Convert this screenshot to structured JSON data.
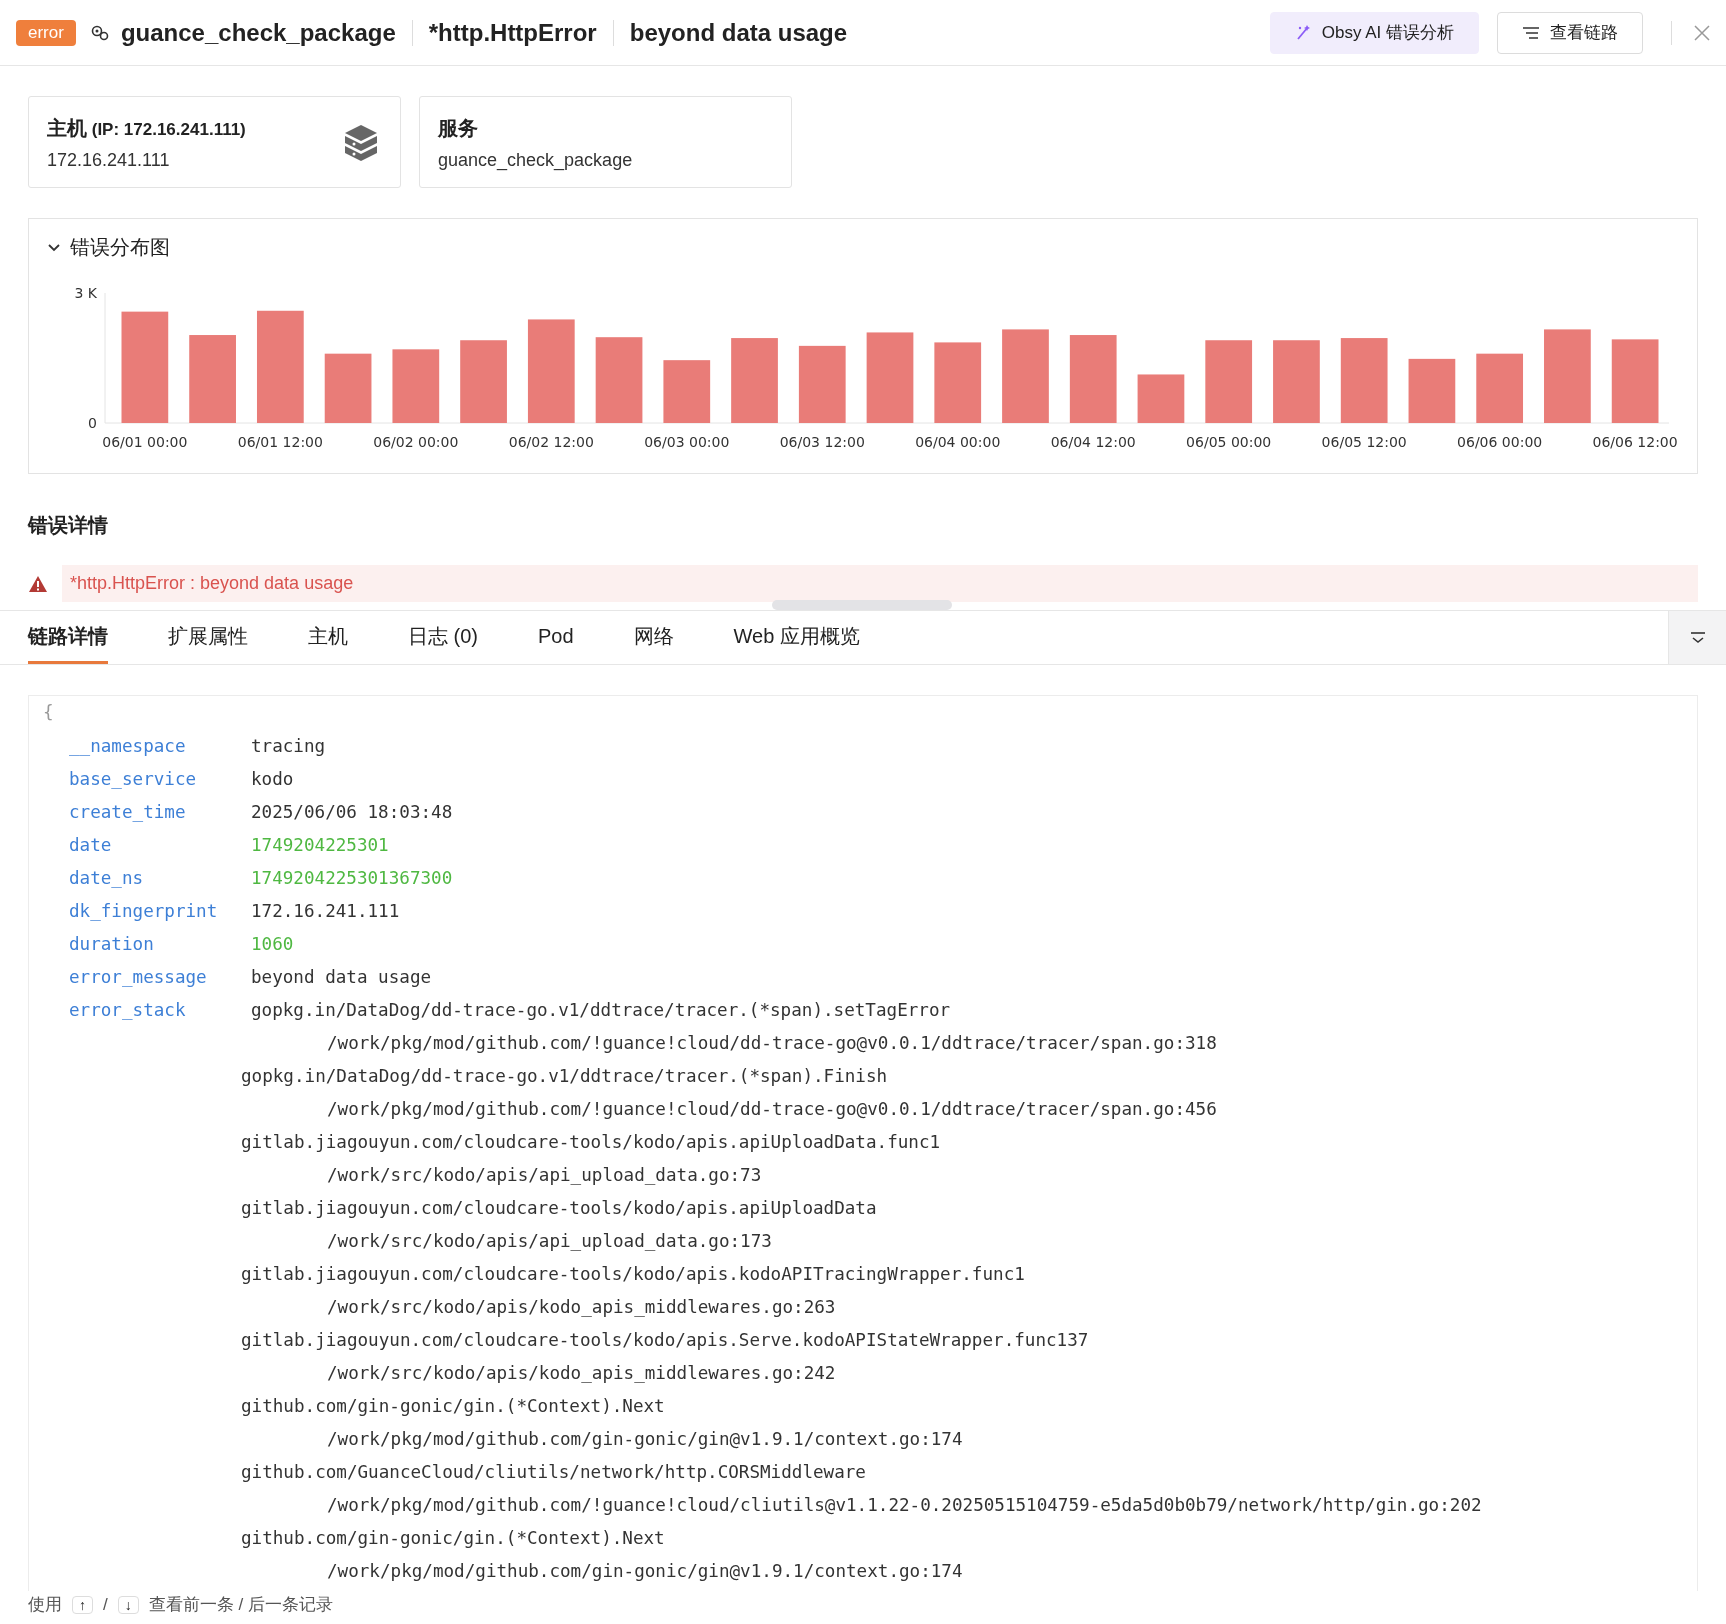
{
  "header": {
    "badge": "error",
    "service": "guance_check_package",
    "error_type": "*http.HttpError",
    "message": "beyond data usage",
    "buttons": [
      {
        "label": "Obsy AI 错误分析",
        "kind": "ai"
      },
      {
        "label": "查看链路",
        "kind": "trace"
      }
    ]
  },
  "cards": [
    {
      "kind": "host",
      "title": "主机",
      "subtitle": "(IP: 172.16.241.111)",
      "value": "172.16.241.111"
    },
    {
      "kind": "service",
      "title": "服务",
      "value": "guance_check_package"
    }
  ],
  "chart_panel": {
    "title": "错误分布图",
    "expanded": true,
    "chart_data": {
      "type": "bar",
      "categories": [
        "06/01 00:00",
        null,
        "06/01 12:00",
        null,
        "06/02 00:00",
        null,
        "06/02 12:00",
        null,
        "06/03 00:00",
        null,
        "06/03 12:00",
        null,
        "06/04 00:00",
        null,
        "06/04 12:00",
        null,
        "06/05 00:00",
        null,
        "06/05 12:00",
        null,
        "06/06 00:00",
        null,
        "06/06 12:00"
      ],
      "series": [
        {
          "color": "#e97c78",
          "values": [
            2570,
            2030,
            2590,
            1600,
            1700,
            1910,
            2390,
            1980,
            1450,
            1960,
            1780,
            2090,
            1860,
            2160,
            2030,
            1120,
            1910,
            1910,
            1960,
            1480,
            1600,
            2160,
            1930
          ]
        }
      ],
      "ylim": [
        0,
        3000
      ],
      "yticks": [
        {
          "value": 0,
          "label": "0"
        },
        {
          "value": 3000,
          "label": "3 K"
        }
      ]
    }
  },
  "details": {
    "title": "错误详情",
    "error": "*http.HttpError : beyond data usage"
  },
  "tabs": [
    {
      "label": "链路详情",
      "selected": true
    },
    {
      "label": "扩展属性",
      "selected": false
    },
    {
      "label": "主机",
      "selected": false
    },
    {
      "label": "日志 (0)",
      "selected": false
    },
    {
      "label": "Pod",
      "selected": false
    },
    {
      "label": "网络",
      "selected": false
    },
    {
      "label": "Web 应用概览",
      "selected": false
    }
  ],
  "json_view": {
    "open_brace": "{",
    "fields": [
      {
        "key": "__namespace",
        "value": "tracing",
        "kind": "string"
      },
      {
        "key": "base_service",
        "value": "kodo",
        "kind": "string"
      },
      {
        "key": "create_time",
        "value": "2025/06/06 18:03:48",
        "kind": "string"
      },
      {
        "key": "date",
        "value": "1749204225301",
        "kind": "number"
      },
      {
        "key": "date_ns",
        "value": "1749204225301367300",
        "kind": "number"
      },
      {
        "key": "dk_fingerprint",
        "value": "172.16.241.111",
        "kind": "string"
      },
      {
        "key": "duration",
        "value": "1060",
        "kind": "number"
      },
      {
        "key": "error_message",
        "value": "beyond data usage",
        "kind": "string"
      },
      {
        "key": "error_stack",
        "value": "gopkg.in/DataDog/dd-trace-go.v1/ddtrace/tracer.(*span).setTagError",
        "kind": "string"
      }
    ],
    "stack_lines": [
      {
        "text": "/work/pkg/mod/github.com/!guance!cloud/dd-trace-go@v0.0.1/ddtrace/tracer/span.go:318",
        "kind": "path"
      },
      {
        "text": "gopkg.in/DataDog/dd-trace-go.v1/ddtrace/tracer.(*span).Finish",
        "kind": "func"
      },
      {
        "text": "/work/pkg/mod/github.com/!guance!cloud/dd-trace-go@v0.0.1/ddtrace/tracer/span.go:456",
        "kind": "path"
      },
      {
        "text": "gitlab.jiagouyun.com/cloudcare-tools/kodo/apis.apiUploadData.func1",
        "kind": "func"
      },
      {
        "text": "/work/src/kodo/apis/api_upload_data.go:73",
        "kind": "path"
      },
      {
        "text": "gitlab.jiagouyun.com/cloudcare-tools/kodo/apis.apiUploadData",
        "kind": "func"
      },
      {
        "text": "/work/src/kodo/apis/api_upload_data.go:173",
        "kind": "path"
      },
      {
        "text": "gitlab.jiagouyun.com/cloudcare-tools/kodo/apis.kodoAPITracingWrapper.func1",
        "kind": "func"
      },
      {
        "text": "/work/src/kodo/apis/kodo_apis_middlewares.go:263",
        "kind": "path"
      },
      {
        "text": "gitlab.jiagouyun.com/cloudcare-tools/kodo/apis.Serve.kodoAPIStateWrapper.func137",
        "kind": "func"
      },
      {
        "text": "/work/src/kodo/apis/kodo_apis_middlewares.go:242",
        "kind": "path"
      },
      {
        "text": "github.com/gin-gonic/gin.(*Context).Next",
        "kind": "func"
      },
      {
        "text": "/work/pkg/mod/github.com/gin-gonic/gin@v1.9.1/context.go:174",
        "kind": "path"
      },
      {
        "text": "github.com/GuanceCloud/cliutils/network/http.CORSMiddleware",
        "kind": "func"
      },
      {
        "text": "/work/pkg/mod/github.com/!guance!cloud/cliutils@v1.1.22-0.20250515104759-e5da5d0b0b79/network/http/gin.go:202",
        "kind": "path"
      },
      {
        "text": "github.com/gin-gonic/gin.(*Context).Next",
        "kind": "func"
      },
      {
        "text": "/work/pkg/mod/github.com/gin-gonic/gin@v1.9.1/context.go:174",
        "kind": "path"
      }
    ]
  },
  "footer": {
    "prefix": "使用",
    "keys": [
      "↑",
      "↓"
    ],
    "separator": "/",
    "suffix": "查看前一条 / 后一条记录"
  }
}
